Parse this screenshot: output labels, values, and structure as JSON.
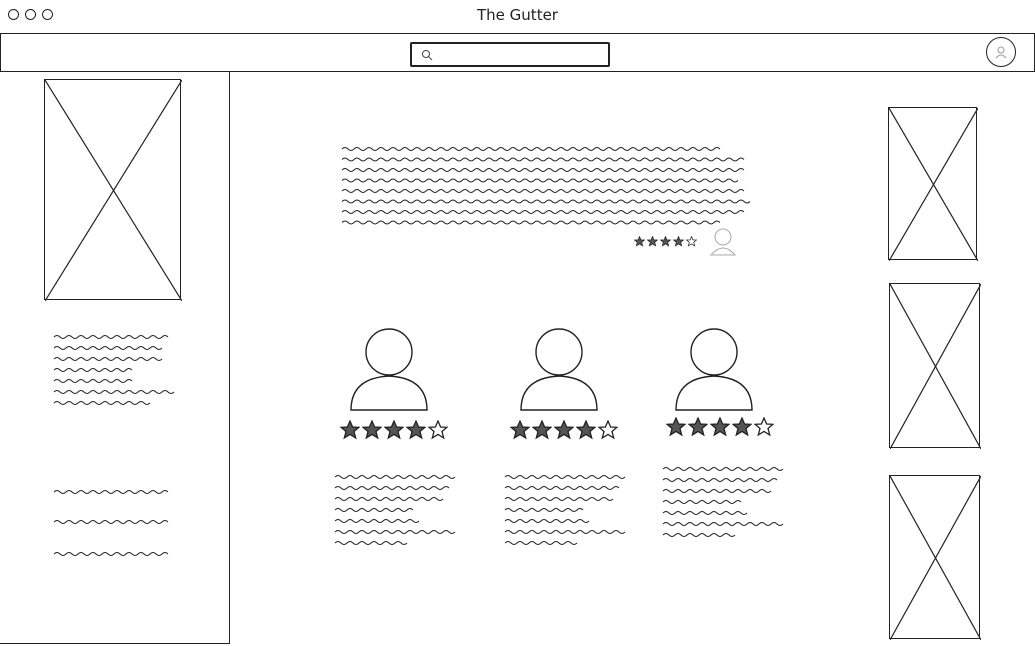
{
  "window": {
    "title": "The Gutter"
  },
  "search": {
    "placeholder": "",
    "icon": "search-icon"
  },
  "profile": {
    "icon": "user-icon"
  },
  "featured_post": {
    "rating": 4,
    "max_rating": 5,
    "avatar_icon": "user-avatar-icon"
  },
  "reviewers": [
    {
      "rating": 4,
      "max_rating": 5
    },
    {
      "rating": 4,
      "max_rating": 5
    },
    {
      "rating": 4,
      "max_rating": 5
    }
  ]
}
